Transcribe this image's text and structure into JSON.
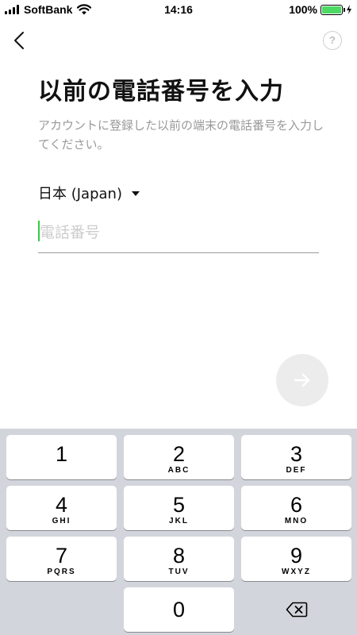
{
  "status_bar": {
    "carrier": "SoftBank",
    "time": "14:16",
    "battery_percent": "100%",
    "battery_level": 1.0,
    "battery_color": "#4cd964"
  },
  "nav": {
    "back_icon": "chevron-left-icon",
    "help_label": "?"
  },
  "content": {
    "title": "以前の電話番号を入力",
    "description": "アカウントに登録した以前の端末の電話番号を入力してください。",
    "country": "日本 (Japan)",
    "phone_placeholder": "電話番号",
    "phone_value": "",
    "cursor_color": "#2fcc40"
  },
  "next_button": {
    "icon": "arrow-right-icon",
    "background": "#ececec"
  },
  "keypad": {
    "keys": [
      {
        "num": "1",
        "letters": ""
      },
      {
        "num": "2",
        "letters": "ABC"
      },
      {
        "num": "3",
        "letters": "DEF"
      },
      {
        "num": "4",
        "letters": "GHI"
      },
      {
        "num": "5",
        "letters": "JKL"
      },
      {
        "num": "6",
        "letters": "MNO"
      },
      {
        "num": "7",
        "letters": "PQRS"
      },
      {
        "num": "8",
        "letters": "TUV"
      },
      {
        "num": "9",
        "letters": "WXYZ"
      },
      {
        "num": "0",
        "letters": ""
      }
    ],
    "delete_icon": "backspace-icon"
  }
}
